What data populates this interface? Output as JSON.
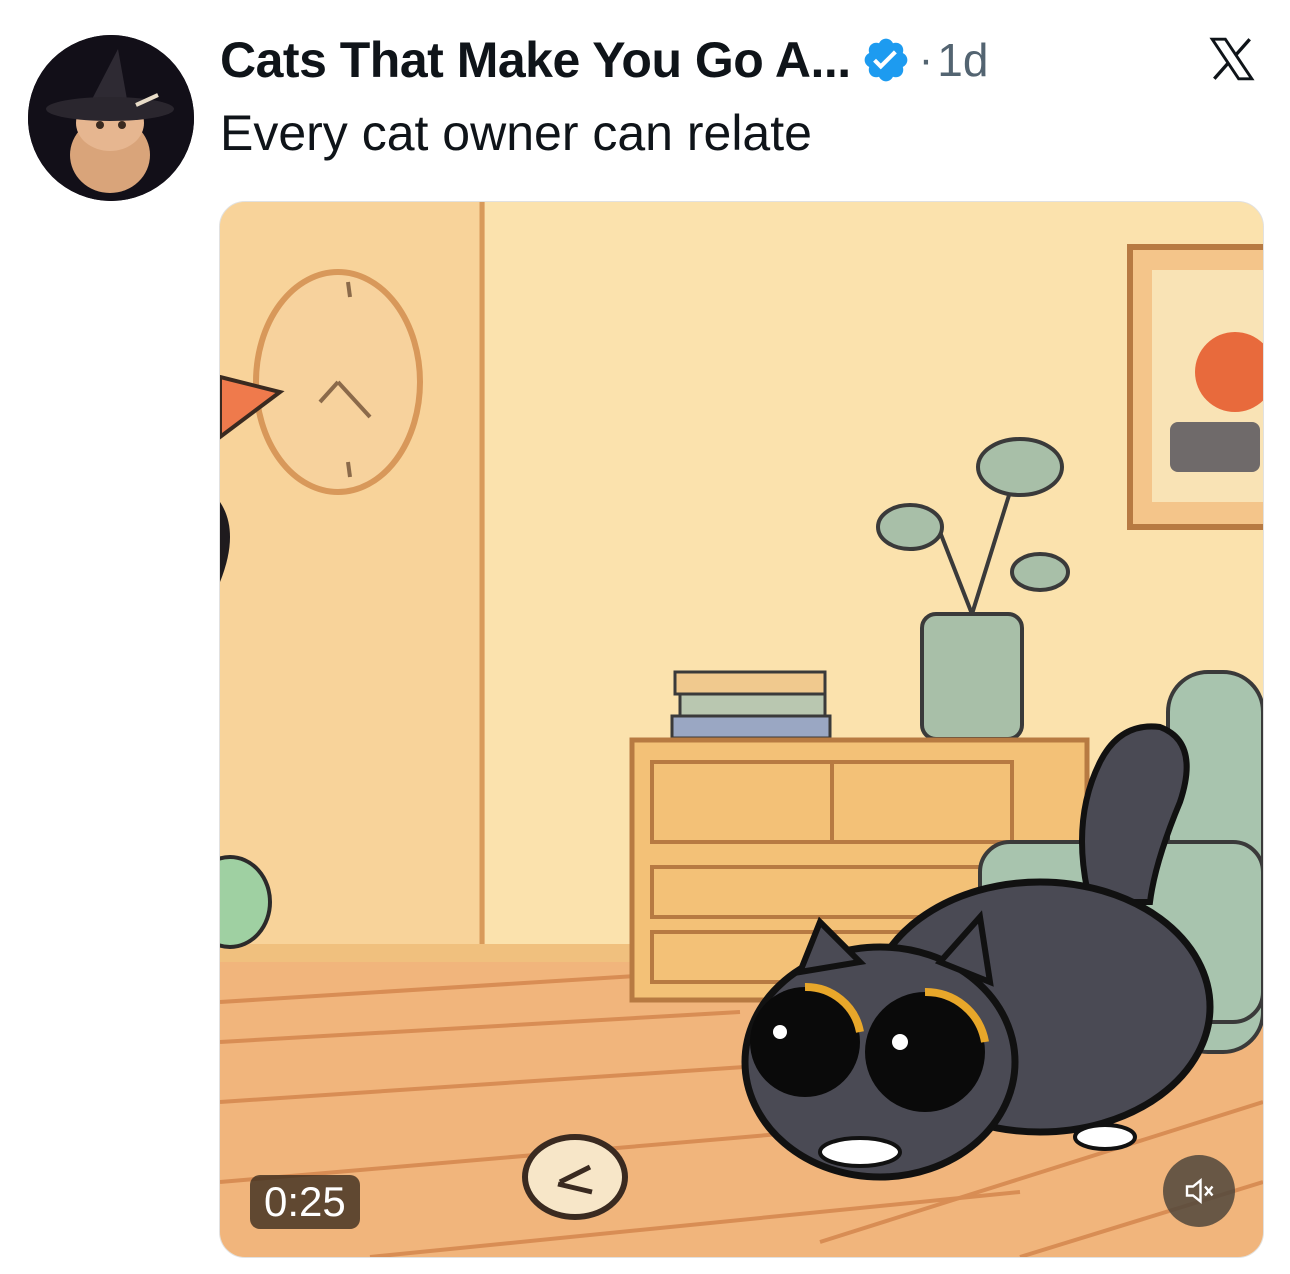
{
  "tweet": {
    "author_name": "Cats That Make You Go A...",
    "time_separator": "·",
    "time": "1d",
    "text": "Every cat owner can relate"
  },
  "media": {
    "duration": "0:25"
  },
  "icons": {
    "verified": "verified-badge-icon",
    "brand": "x-logo-icon",
    "mute": "volume-muted-icon"
  },
  "colors": {
    "text_primary": "#0f1419",
    "text_secondary": "#536471",
    "verified": "#1d9bf0"
  }
}
